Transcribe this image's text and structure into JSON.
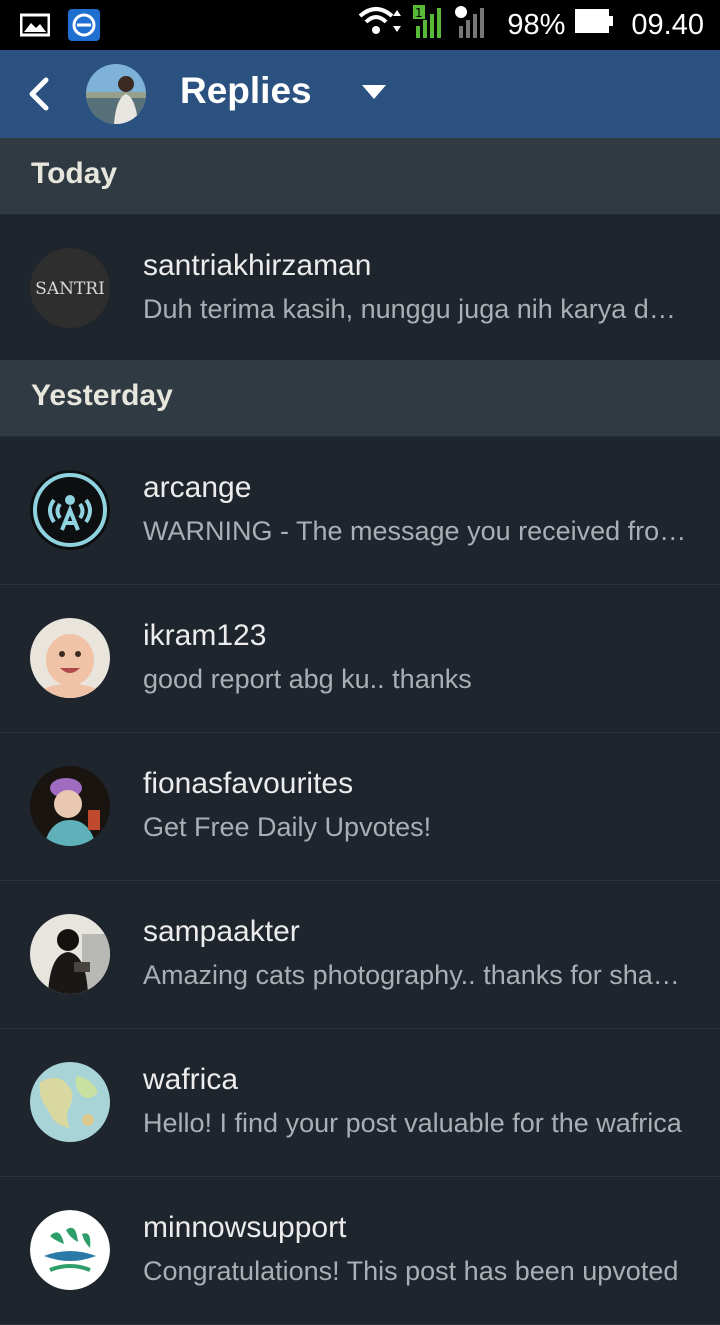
{
  "status_bar": {
    "battery": "98%",
    "time": "09.40",
    "sim_badge": "1",
    "icons": [
      "gallery-icon",
      "browser-icon",
      "wifi-icon",
      "signal-icon",
      "battery-icon"
    ]
  },
  "header": {
    "title": "Replies",
    "back_icon": "chevron-left-icon",
    "dropdown_icon": "caret-down-icon",
    "bg_color": "#2b5181"
  },
  "sections": [
    {
      "label": "Today",
      "items": [
        {
          "username": "santriakhirzaman",
          "message": "Duh terima kasih, nunggu juga nih karya dari…",
          "avatar_text": "SANTRI"
        }
      ]
    },
    {
      "label": "Yesterday",
      "items": [
        {
          "username": "arcange",
          "message": "WARNING - The message you received from…"
        },
        {
          "username": "ikram123",
          "message": "good report abg ku.. thanks"
        },
        {
          "username": "fionasfavourites",
          "message": "Get Free Daily Upvotes!"
        },
        {
          "username": "sampaakter",
          "message": "Amazing cats photography.. thanks for sharing"
        },
        {
          "username": "wafrica",
          "message": "Hello! I find your post valuable for the wafrica"
        },
        {
          "username": "minnowsupport",
          "message": "Congratulations! This post has been upvoted"
        }
      ]
    }
  ]
}
